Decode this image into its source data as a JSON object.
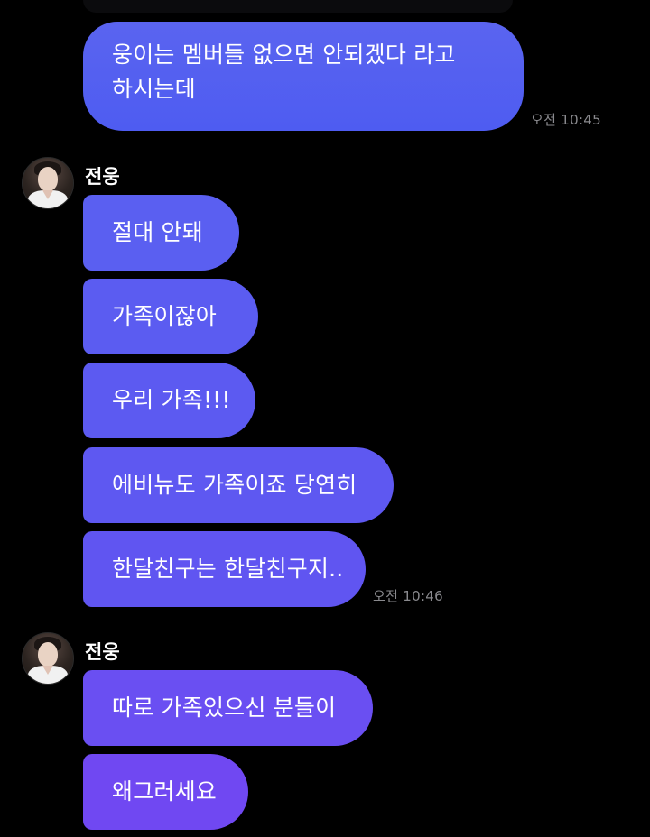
{
  "colors": {
    "background": "#000000",
    "time_text": "#8a8a8e"
  },
  "messages_top": {
    "text": "웅이는 멤버들 없으면 안되겠다 라고 하시는데",
    "time": "오전 10:45"
  },
  "group1": {
    "sender": "전웅",
    "avatar_icon": "profile-avatar",
    "bubbles": [
      {
        "text": "절대 안돼",
        "color": "#5a5ff1"
      },
      {
        "text": "가족이잖아",
        "color": "#5b5cf1"
      },
      {
        "text": "우리 가족!!!",
        "color": "#5c5af1"
      },
      {
        "text": "에비뉴도 가족이죠 당연히",
        "color": "#5e58f1"
      },
      {
        "text": "한달친구는 한달친구지..",
        "color": "#6055f1"
      }
    ],
    "time": "오전 10:46"
  },
  "group2": {
    "sender": "전웅",
    "avatar_icon": "profile-avatar",
    "bubbles": [
      {
        "text": "따로 가족있으신 분들이",
        "color": "#6a4ff2"
      },
      {
        "text": "왜그러세요",
        "color": "#7048f2"
      }
    ]
  }
}
